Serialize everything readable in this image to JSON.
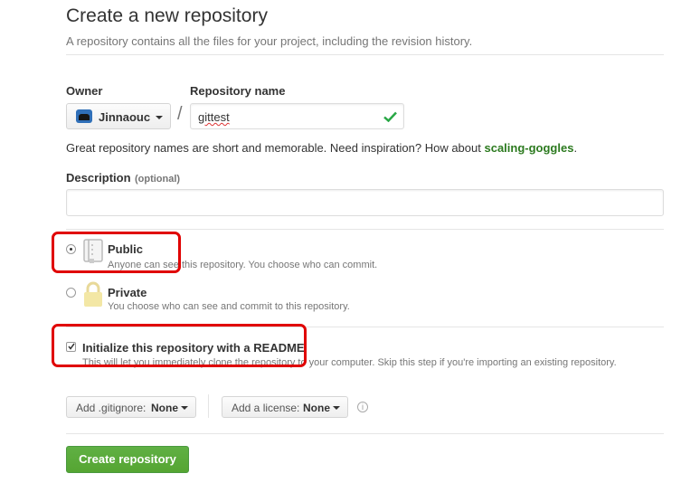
{
  "header": {
    "title": "Create a new repository",
    "subtitle": "A repository contains all the files for your project, including the revision history."
  },
  "owner": {
    "label": "Owner",
    "value": "Jinnaouc"
  },
  "repo_name": {
    "label": "Repository name",
    "value": "gittest"
  },
  "hint": {
    "text": "Great repository names are short and memorable. Need inspiration? How about",
    "suggestion": "scaling-goggles",
    "end": "."
  },
  "description": {
    "label": "Description",
    "optional": "(optional)",
    "value": ""
  },
  "visibility": {
    "public": {
      "label": "Public",
      "desc": "Anyone can see this repository. You choose who can commit.",
      "selected": true
    },
    "private": {
      "label": "Private",
      "desc": "You choose who can see and commit to this repository.",
      "selected": false
    }
  },
  "readme": {
    "label": "Initialize this repository with a README",
    "desc": "This will let you immediately clone the repository to your computer. Skip this step if you're importing an existing repository.",
    "checked": true
  },
  "gitignore": {
    "label": "Add .gitignore:",
    "value": "None"
  },
  "license": {
    "label": "Add a license:",
    "value": "None"
  },
  "submit": {
    "label": "Create repository"
  },
  "colors": {
    "accent_green": "#28a745",
    "button_green": "#55a532",
    "highlight_red": "#e00000",
    "link_green": "#2c7a1f"
  }
}
